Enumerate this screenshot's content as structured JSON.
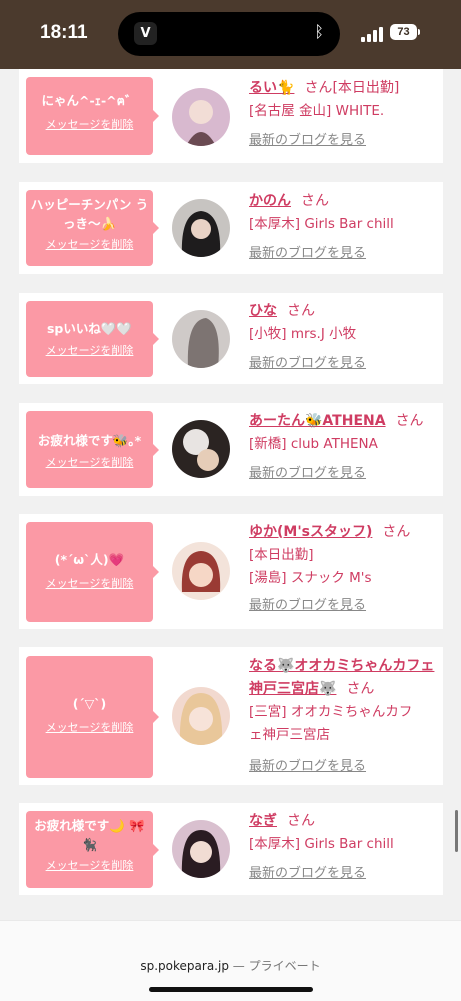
{
  "status": {
    "time": "18:11",
    "battery": "73"
  },
  "cards": [
    {
      "message": "にゃん^-ｪ-^ฅ゛",
      "delete_label": "メッセージを削除",
      "name": "るい🐈",
      "san": "さん",
      "shop_lines": [
        "[本日出勤]",
        "[名古屋 金山] WHITE."
      ],
      "blog_label": "最新のブログを見る",
      "avatar_colors": [
        "#d8b9cf",
        "#6a4a52"
      ]
    },
    {
      "message": "ハッピーチンパン うっき〜🍌",
      "delete_label": "メッセージを削除",
      "name": "かのん",
      "san": "さん",
      "shop_lines": [
        "[本厚木] Girls Bar chill"
      ],
      "blog_label": "最新のブログを見る",
      "avatar_colors": [
        "#c7c4c1",
        "#1e1c1d"
      ]
    },
    {
      "message": "spいいね🤍🤍",
      "delete_label": "メッセージを削除",
      "name": "ひな",
      "san": "さん",
      "shop_lines": [
        "[小牧] mrs.J 小牧"
      ],
      "blog_label": "最新のブログを見る",
      "avatar_colors": [
        "#cfcac8",
        "#7d7472"
      ]
    },
    {
      "message": "お疲れ様です🐝｡*",
      "delete_label": "メッセージを削除",
      "name": "あーたん🐝ATHENA",
      "san": "さん",
      "shop_lines": [
        "[新橋] club ATHENA"
      ],
      "blog_label": "最新のブログを見る",
      "avatar_colors": [
        "#e8e4e2",
        "#2b2422"
      ]
    },
    {
      "message": "(*´ω`人)💗",
      "delete_label": "メッセージを削除",
      "name": "ゆか(M'sスタッフ)",
      "san": "さん",
      "shop_lines": [
        "[本日出勤]",
        "[湯島] スナック M's"
      ],
      "blog_label": "最新のブログを見る",
      "avatar_colors": [
        "#f3e3da",
        "#9a3b34"
      ]
    },
    {
      "message": "(´▽`)",
      "delete_label": "メッセージを削除",
      "name": "なる🐺オオカミちゃんカフェ神戸三宮店🐺",
      "san": "さん",
      "shop_lines": [
        "[三宮] オオカミちゃんカフ",
        "ェ神戸三宮店"
      ],
      "blog_label": "最新のブログを見る",
      "avatar_colors": [
        "#e9c79a",
        "#f2d9cf"
      ]
    },
    {
      "message": "お疲れ様です🌙 🎀🐈‍⬛",
      "delete_label": "メッセージを削除",
      "name": "なぎ",
      "san": "さん",
      "shop_lines": [
        "[本厚木] Girls Bar chill"
      ],
      "blog_label": "最新のブログを見る",
      "avatar_colors": [
        "#d9c0cf",
        "#2a1c22"
      ]
    }
  ],
  "footer": {
    "url": "sp.pokepara.jp",
    "separator": "—",
    "mode": "プライベート"
  },
  "colors": {
    "accent": "#cf3c62",
    "bubble": "#fb99a5",
    "status_bar": "#4b3a2d"
  }
}
